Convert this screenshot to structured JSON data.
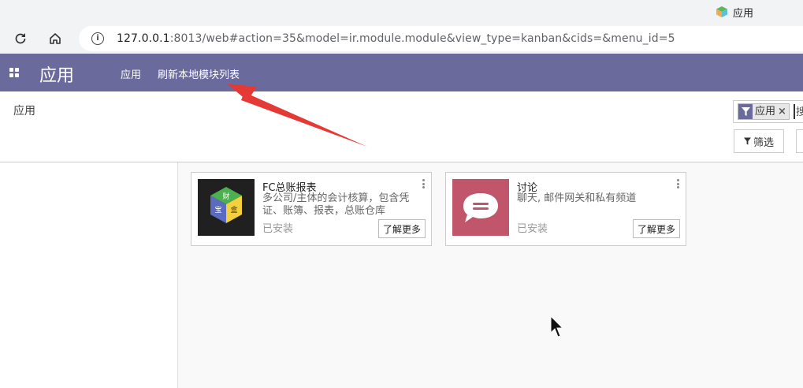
{
  "browser": {
    "tab_title": "应用",
    "url_host": "127.0.0.1",
    "url_path": ":8013/web#action=35&model=ir.module.module&view_type=kanban&cids=&menu_id=5",
    "icons": [
      "reload-icon",
      "home-icon",
      "site-info-icon",
      "app-favicon"
    ]
  },
  "navbar": {
    "brand": "应用",
    "menu": [
      "应用",
      "刷新本地模块列表"
    ],
    "color": "#6b6a9c"
  },
  "control_panel": {
    "breadcrumb": "应用",
    "search": {
      "facet_label": "应用",
      "input_text": "搜"
    },
    "filter_label": "筛选"
  },
  "cards": [
    {
      "title": "FC总账报表",
      "description": "多公司/主体的会计核算，包含凭证、账簿、报表，总账仓库",
      "status": "已安装",
      "button": "了解更多",
      "icon_chars": [
        "财",
        "宝",
        "盒"
      ]
    },
    {
      "title": "讨论",
      "description": "聊天, 邮件网关和私有频道",
      "status": "已安装",
      "button": "了解更多"
    }
  ],
  "annotation": {
    "color": "#e53935",
    "icon": "red-arrow-icon"
  }
}
